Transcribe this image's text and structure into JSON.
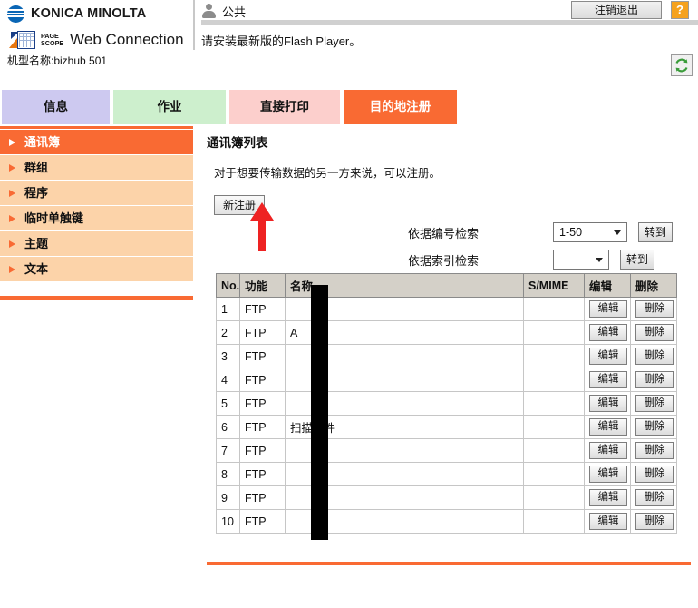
{
  "header": {
    "brand_primary": "KONICA MINOLTA",
    "brand_page": "PAGE",
    "brand_scope": "SCOPE",
    "brand_product": "Web Connection",
    "model_label": "机型名称:bizhub 501",
    "user_icon": "user-icon",
    "user_name": "公共",
    "logout_label": "注销退出",
    "help_label": "?",
    "flash_notice": "请安装最新版的Flash Player。",
    "refresh_icon": "refresh-icon"
  },
  "tabs": [
    {
      "label": "信息",
      "color": "#cdc9f0",
      "active": false
    },
    {
      "label": "作业",
      "color": "#cdefcd",
      "active": false
    },
    {
      "label": "直接打印",
      "color": "#fccfcc",
      "active": false
    },
    {
      "label": "目的地注册",
      "color": "#f96a33",
      "active": true
    }
  ],
  "sidebar": {
    "items": [
      {
        "label": "通讯簿",
        "active": true
      },
      {
        "label": "群组",
        "active": false
      },
      {
        "label": "程序",
        "active": false
      },
      {
        "label": "临时单触键",
        "active": false
      },
      {
        "label": "主题",
        "active": false
      },
      {
        "label": "文本",
        "active": false
      }
    ]
  },
  "main": {
    "title": "通讯簿列表",
    "description": "对于想要传输数据的另一方来说，可以注册。",
    "new_register_label": "新注册",
    "annotation_arrow": "red-up-arrow pointing at 新注册 button"
  },
  "search": {
    "by_number_label": "依据编号检索",
    "by_number_value": "1-50",
    "by_index_label": "依据索引检索",
    "by_index_value": "",
    "goto_label_1": "转到",
    "goto_label_2": "转到"
  },
  "table": {
    "columns": [
      "No.",
      "功能",
      "名称",
      "S/MIME",
      "编辑",
      "删除"
    ],
    "edit_label": "编辑",
    "delete_label": "删除",
    "rows": [
      {
        "no": "1",
        "function": "FTP",
        "name": "",
        "smime": ""
      },
      {
        "no": "2",
        "function": "FTP",
        "name": "A",
        "smime": ""
      },
      {
        "no": "3",
        "function": "FTP",
        "name": "",
        "smime": ""
      },
      {
        "no": "4",
        "function": "FTP",
        "name": "",
        "smime": ""
      },
      {
        "no": "5",
        "function": "FTP",
        "name": "",
        "smime": ""
      },
      {
        "no": "6",
        "function": "FTP",
        "name": "扫描文件",
        "smime": ""
      },
      {
        "no": "7",
        "function": "FTP",
        "name": "",
        "smime": ""
      },
      {
        "no": "8",
        "function": "FTP",
        "name": "",
        "smime": ""
      },
      {
        "no": "9",
        "function": "FTP",
        "name": "",
        "smime": ""
      },
      {
        "no": "10",
        "function": "FTP",
        "name": "",
        "smime": ""
      }
    ]
  },
  "colors": {
    "accent_orange": "#f96a33",
    "sidebar_bg": "#fcd3a9",
    "tab_info": "#cdc9f0",
    "tab_job": "#cdefcd",
    "tab_print": "#fccfcc",
    "annotation_red": "#ee2222",
    "help_orange": "#f5a21e"
  }
}
